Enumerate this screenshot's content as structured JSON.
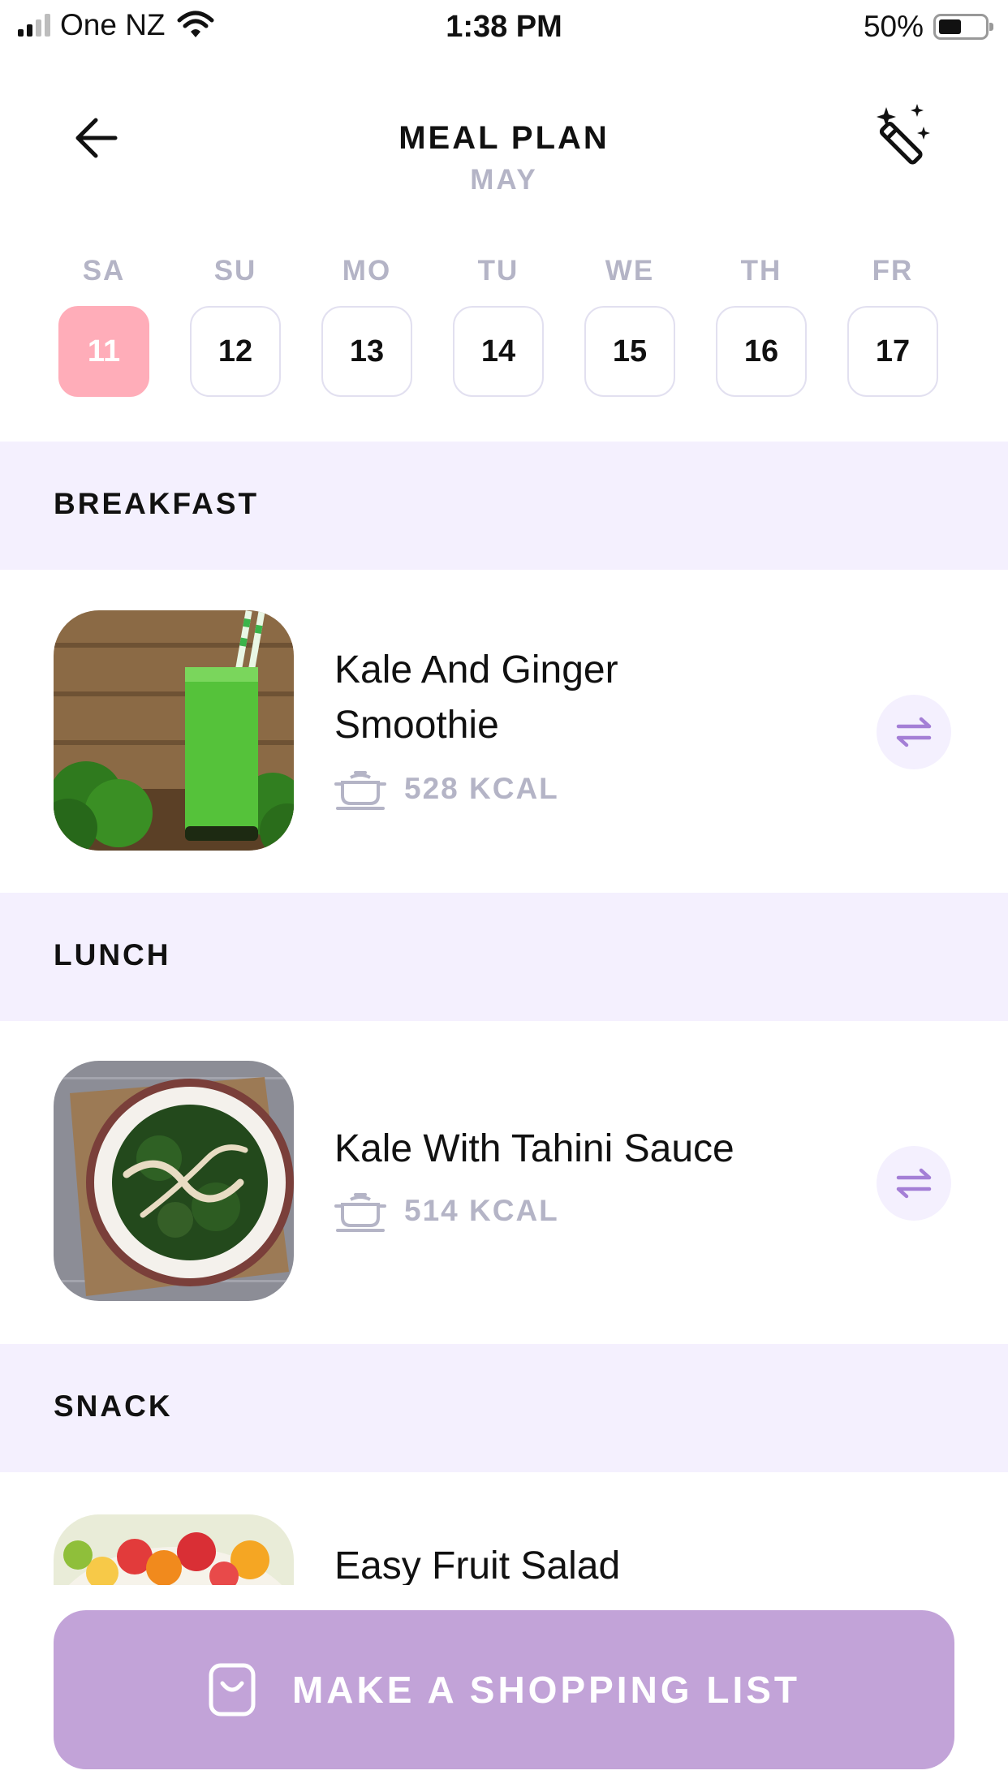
{
  "status_bar": {
    "carrier": "One NZ",
    "time": "1:38 PM",
    "battery_percent": "50%",
    "battery_level": 0.5,
    "signal_bars_active": 2,
    "signal_bars_total": 4
  },
  "header": {
    "title": "MEAL PLAN",
    "subtitle": "MAY",
    "left_icon": "back-arrow-icon",
    "right_icon": "magic-wand-icon"
  },
  "week": {
    "days": [
      {
        "weekday": "SA",
        "date": "11",
        "selected": true
      },
      {
        "weekday": "SU",
        "date": "12",
        "selected": false
      },
      {
        "weekday": "MO",
        "date": "13",
        "selected": false
      },
      {
        "weekday": "TU",
        "date": "14",
        "selected": false
      },
      {
        "weekday": "WE",
        "date": "15",
        "selected": false
      },
      {
        "weekday": "TH",
        "date": "16",
        "selected": false
      },
      {
        "weekday": "FR",
        "date": "17",
        "selected": false
      }
    ]
  },
  "sections": [
    {
      "label": "BREAKFAST",
      "meal": {
        "name": "Kale And Ginger Smoothie",
        "kcal": "528 KCAL"
      }
    },
    {
      "label": "LUNCH",
      "meal": {
        "name": "Kale With Tahini Sauce",
        "kcal": "514 KCAL"
      }
    },
    {
      "label": "SNACK",
      "meal": {
        "name": "Easy Fruit Salad",
        "kcal": ""
      }
    }
  ],
  "bottom_button": {
    "label": "MAKE A SHOPPING LIST",
    "icon": "shopping-bag-icon"
  },
  "colors": {
    "selected_day": "#ffadb9",
    "section_band": "#f4f0fe",
    "muted_text": "#b4b4c6",
    "accent_purple": "#a47fd6",
    "button": "#c2a3d8"
  }
}
